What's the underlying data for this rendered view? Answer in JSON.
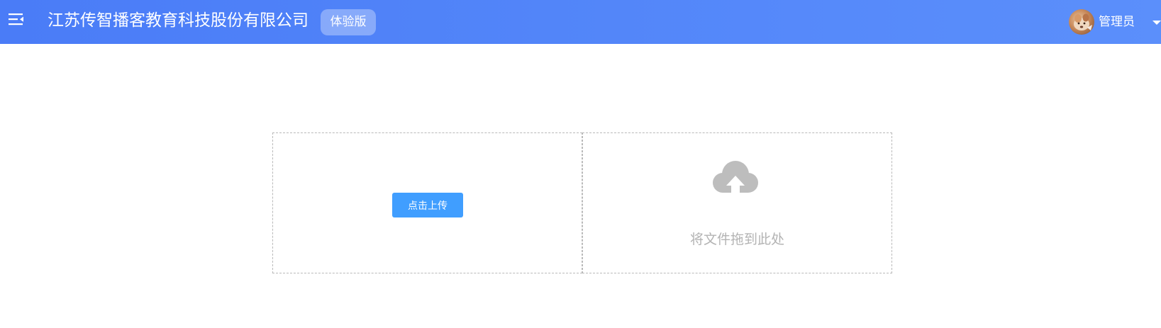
{
  "header": {
    "company_name": "江苏传智播客教育科技股份有限公司",
    "edition_badge": "体验版",
    "user_name": "管理员",
    "menu_icon": "menu-fold-icon",
    "caret_icon": "caret-down-icon"
  },
  "upload": {
    "button_label": "点击上传",
    "drop_text": "将文件拖到此处",
    "cloud_icon": "cloud-upload-icon"
  },
  "colors": {
    "header_start": "#4a7cf7",
    "header_end": "#5b8ffb",
    "button": "#409eff",
    "icon_gray": "#bdbdbd"
  }
}
